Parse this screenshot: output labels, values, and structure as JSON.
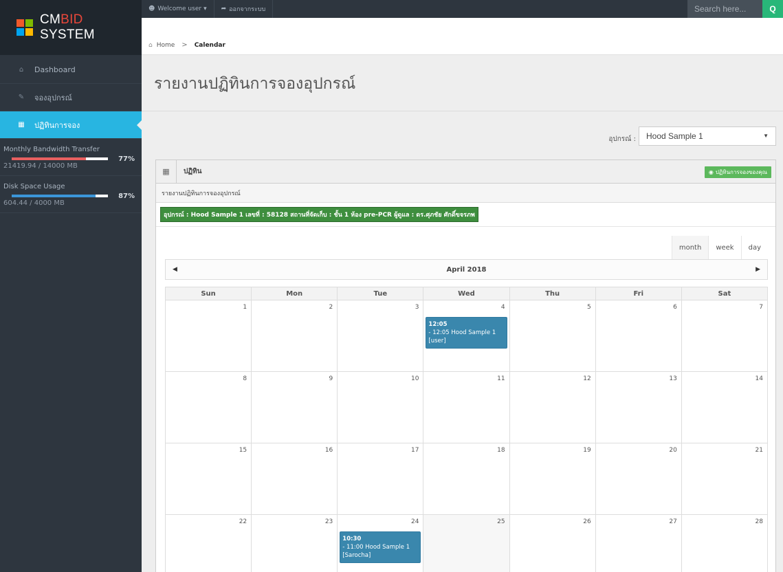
{
  "brand": {
    "prefix": "CM",
    "accent": "BID",
    "suffix": " SYSTEM"
  },
  "topbar": {
    "welcome": "Welcome user",
    "logout": "ออกจากระบบ",
    "search_placeholder": "Search here...",
    "search_button": "Q"
  },
  "breadcrumb": {
    "home": "Home",
    "separator": ">",
    "current": "Calendar"
  },
  "sidebar": {
    "items": [
      {
        "label": "Dashboard",
        "icon": "home-icon"
      },
      {
        "label": "จองอุปกรณ์",
        "icon": "pencil-icon"
      },
      {
        "label": "ปฏิทินการจอง",
        "icon": "calendar-icon"
      }
    ],
    "bandwidth": {
      "label": "Monthly Bandwidth Transfer",
      "percent": "77%",
      "fraction": 0.77,
      "detail": "21419.94 / 14000 MB"
    },
    "disk": {
      "label": "Disk Space Usage",
      "percent": "87%",
      "fraction": 0.87,
      "detail": "604.44 / 4000 MB"
    }
  },
  "main": {
    "title": "รายงานปฏิทินการจองอุปกรณ์",
    "device_label": "อุปกรณ์ :",
    "device_value": "Hood Sample 1"
  },
  "widget": {
    "title": "ปฏิทิน",
    "my_booking": "ปฏิทินการจองของคุณ",
    "subheading": "รายงานปฏิทินการจองอุปกรณ์",
    "info": "อุปกรณ์ : Hood Sample 1 เลขที่ : 58128 สถานที่จัดเก็บ : ชั้น 1 ห้อง pre-PCR ผู้ดูแล : ดร.ศุภชัย ศักดิ์ขจรภพ"
  },
  "calendar": {
    "views": [
      "month",
      "week",
      "day"
    ],
    "month_title": "April 2018",
    "days_of_week": [
      "Sun",
      "Mon",
      "Tue",
      "Wed",
      "Thu",
      "Fri",
      "Sat"
    ],
    "weeks": [
      [
        "1",
        "2",
        "3",
        "4",
        "5",
        "6",
        "7"
      ],
      [
        "8",
        "9",
        "10",
        "11",
        "12",
        "13",
        "14"
      ],
      [
        "15",
        "16",
        "17",
        "18",
        "19",
        "20",
        "21"
      ],
      [
        "22",
        "23",
        "24",
        "25",
        "26",
        "27",
        "28"
      ]
    ],
    "events": [
      {
        "time": "12:05",
        "line1": "- 12:05 Hood Sample 1",
        "line2": "[user]"
      },
      {
        "time": "10:30",
        "line1": "- 11:00 Hood Sample 1",
        "line2": "[Sarocha]"
      }
    ]
  },
  "colors": {
    "sidebar": "#2e363f",
    "active": "#28b5e1",
    "success": "#5cb85c",
    "event": "#3a87ad",
    "bandwidth_bar": "#e86060",
    "disk_bar": "#3b96d9"
  }
}
